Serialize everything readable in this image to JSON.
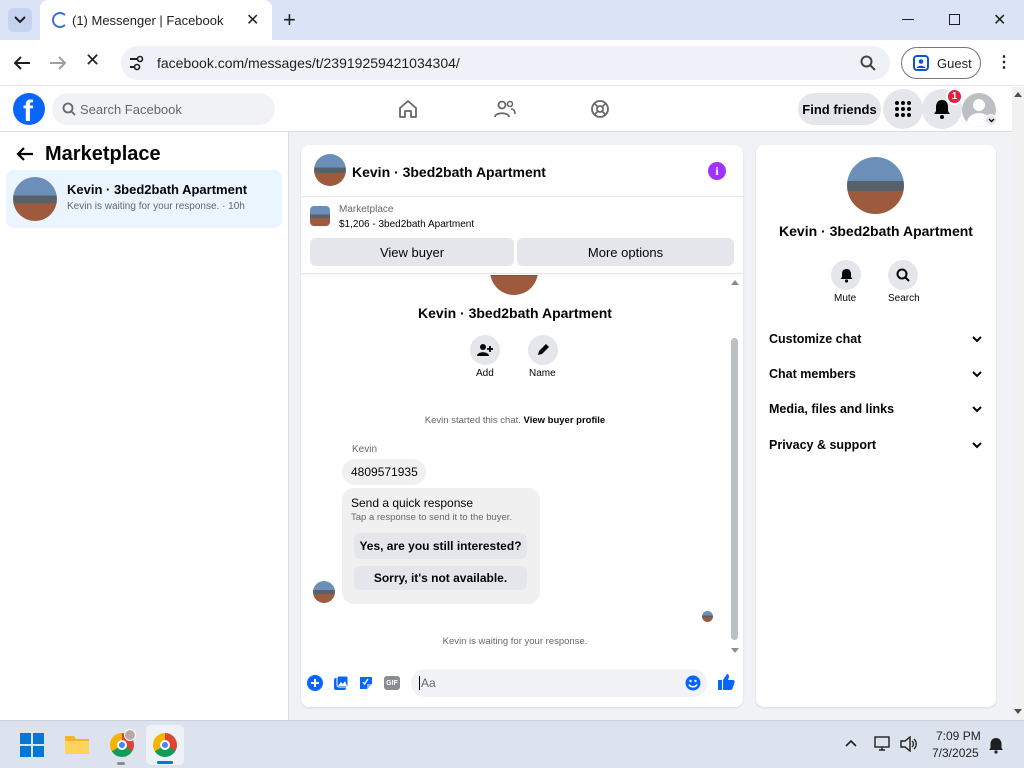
{
  "browser": {
    "tab_title": "(1) Messenger | Facebook",
    "url": "facebook.com/messages/t/23919259421034304/",
    "profile_label": "Guest"
  },
  "fb_header": {
    "search_placeholder": "Search Facebook",
    "find_friends": "Find friends",
    "notification_count": "1"
  },
  "left_panel": {
    "title": "Marketplace",
    "conversations": [
      {
        "name": "Kevin · 3bed2bath Apartment",
        "preview": "Kevin is waiting for your response. · 10h"
      }
    ]
  },
  "chat": {
    "title": "Kevin · 3bed2bath Apartment",
    "listing_category": "Marketplace",
    "listing_detail": "$1,206 - 3bed2bath Apartment",
    "view_buyer": "View buyer",
    "more_options": "More options",
    "profile_name": "Kevin · 3bed2bath Apartment",
    "add_label": "Add",
    "name_label": "Name",
    "started_text": "Kevin started this chat.",
    "view_profile_link": "View buyer profile",
    "sender": "Kevin",
    "message": "4809571935",
    "quick_title": "Send a quick response",
    "quick_sub": "Tap a response to send it to the buyer.",
    "quick_replies": [
      "Yes, are you still interested?",
      "Sorry, it's not available."
    ],
    "waiting": "Kevin is waiting for your response.",
    "composer_placeholder": "Aa"
  },
  "info_panel": {
    "name": "Kevin · 3bed2bath Apartment",
    "mute": "Mute",
    "search": "Search",
    "sections": [
      "Customize chat",
      "Chat members",
      "Media, files and links",
      "Privacy & support"
    ]
  },
  "taskbar": {
    "time": "7:09 PM",
    "date": "7/3/2025"
  },
  "colors": {
    "fb_blue": "#0866ff",
    "messenger_purple": "#a033ff",
    "notification_red": "#e41e3f"
  }
}
